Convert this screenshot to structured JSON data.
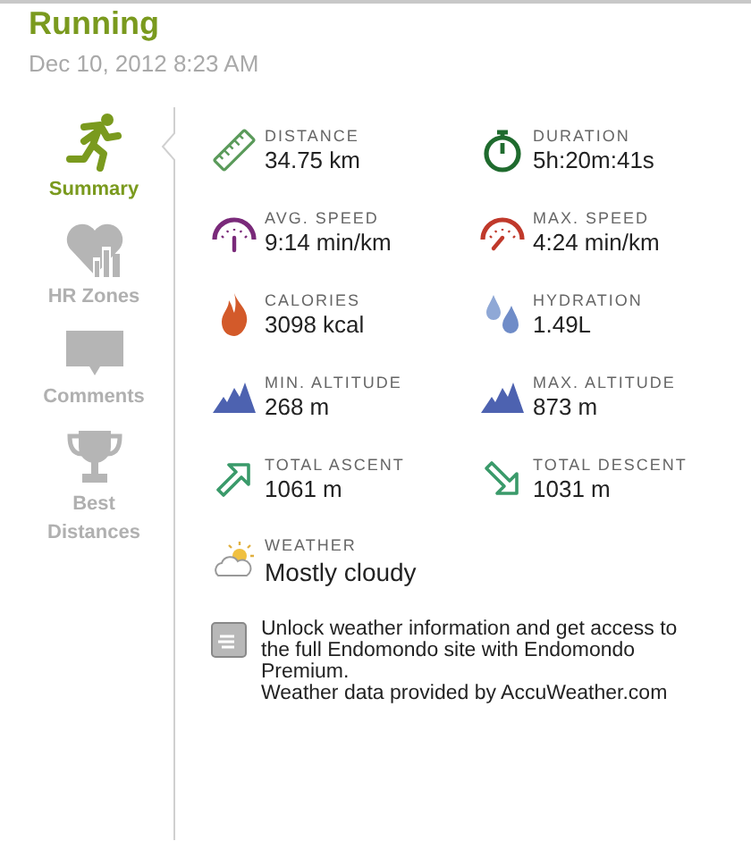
{
  "header": {
    "title": "Running",
    "date": "Dec 10, 2012 8:23 AM"
  },
  "sidebar": {
    "items": [
      {
        "kind": "runner",
        "label": "Summary",
        "selected": true
      },
      {
        "kind": "heart",
        "label": "HR Zones",
        "selected": false
      },
      {
        "kind": "comment",
        "label": "Comments",
        "selected": false
      },
      {
        "kind": "trophy",
        "label": "Best Distances",
        "selected": false
      }
    ]
  },
  "stats": [
    {
      "kind": "ruler",
      "label": "DISTANCE",
      "value": "34.75 km"
    },
    {
      "kind": "stopwatch",
      "label": "DURATION",
      "value": "5h:20m:41s"
    },
    {
      "kind": "gauge-avg",
      "label": "AVG. SPEED",
      "value": "9:14 min/km"
    },
    {
      "kind": "gauge-max",
      "label": "MAX. SPEED",
      "value": "4:24 min/km"
    },
    {
      "kind": "flame",
      "label": "CALORIES",
      "value": "3098 kcal"
    },
    {
      "kind": "drops",
      "label": "HYDRATION",
      "value": "1.49L"
    },
    {
      "kind": "mountain",
      "label": "MIN. ALTITUDE",
      "value": "268 m"
    },
    {
      "kind": "mountain",
      "label": "MAX. ALTITUDE",
      "value": "873 m"
    },
    {
      "kind": "ascent",
      "label": "TOTAL ASCENT",
      "value": "1061 m"
    },
    {
      "kind": "descent",
      "label": "TOTAL DESCENT",
      "value": "1031 m"
    }
  ],
  "weather": {
    "label": "WEATHER",
    "value": "Mostly cloudy"
  },
  "note": {
    "lines": [
      "Unlock weather information and get access to the full Endomondo site with Endomondo Premium.",
      "Weather data provided by AccuWeather.com"
    ]
  }
}
